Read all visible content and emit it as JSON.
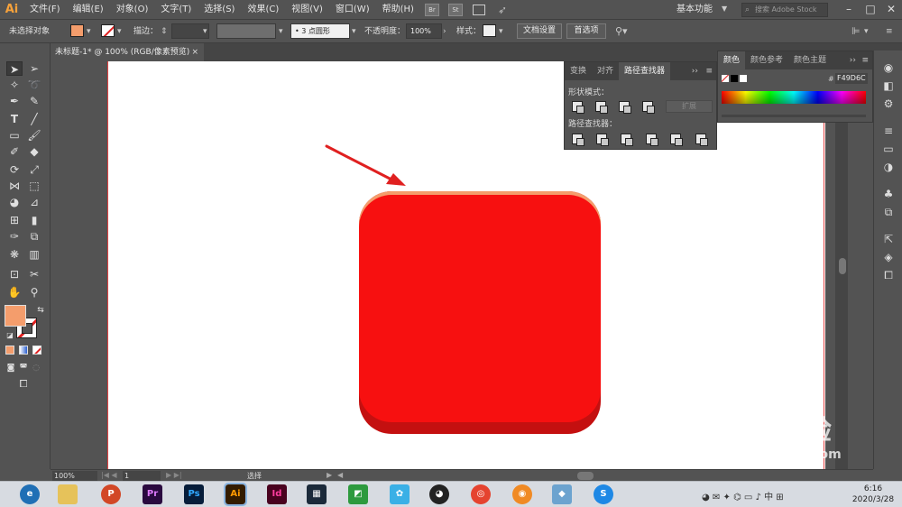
{
  "app": {
    "logo": "Ai",
    "workspace": "基本功能",
    "search_placeholder": "搜索 Adobe Stock"
  },
  "menu": [
    "文件(F)",
    "编辑(E)",
    "对象(O)",
    "文字(T)",
    "选择(S)",
    "效果(C)",
    "视图(V)",
    "窗口(W)",
    "帮助(H)"
  ],
  "app_chips": [
    "Br",
    "St"
  ],
  "controlbar": {
    "selection_label": "未选择对象",
    "stroke_label": "描边：",
    "brush_value": "3 点圆形",
    "opacity_label": "不透明度：",
    "opacity_value": "100%",
    "style_label": "样式：",
    "doc_setup": "文档设置",
    "preferences": "首选项"
  },
  "document_tab": {
    "title": "未标题-1* @ 100% (RGB/像素预览)",
    "close": "×"
  },
  "fill_color": "#F49D6C",
  "pathfinder_panel": {
    "tabs": [
      "变换",
      "对齐",
      "路径查找器"
    ],
    "active_tab": "路径查找器",
    "shape_modes_label": "形状模式：",
    "expand_label": "扩展",
    "pathfinders_label": "路径查找器："
  },
  "color_panel": {
    "tabs": [
      "颜色",
      "颜色参考",
      "颜色主题"
    ],
    "active_tab": "颜色",
    "hex_prefix": "#",
    "hex_value": "F49D6C"
  },
  "statusbar": {
    "zoom": "100%",
    "page": "1",
    "tool": "选择"
  },
  "artwork": {
    "box_color": "#F71010",
    "shadow_color": "#C41010",
    "top_color": "#F49D6C",
    "arrow_color": "#E02020"
  },
  "taskbar": {
    "apps": [
      "Edge",
      "Explorer",
      "PowerPoint",
      "Premiere",
      "Photoshop",
      "Illustrator",
      "InDesign",
      "Video",
      "Media",
      "Bird",
      "QQ",
      "Chrome",
      "Fox",
      "Tile",
      "Search"
    ],
    "labels": [
      "e",
      "",
      "P",
      "Pr",
      "Ps",
      "Ai",
      "Id",
      "▦",
      "◩",
      "✿",
      "◕",
      "◎",
      "◉",
      "◆",
      "S"
    ],
    "time": "6:16",
    "date": "2020/3/28"
  },
  "watermark": {
    "brand": "Bai 经验",
    "url": "jingyan.baidu.com"
  }
}
